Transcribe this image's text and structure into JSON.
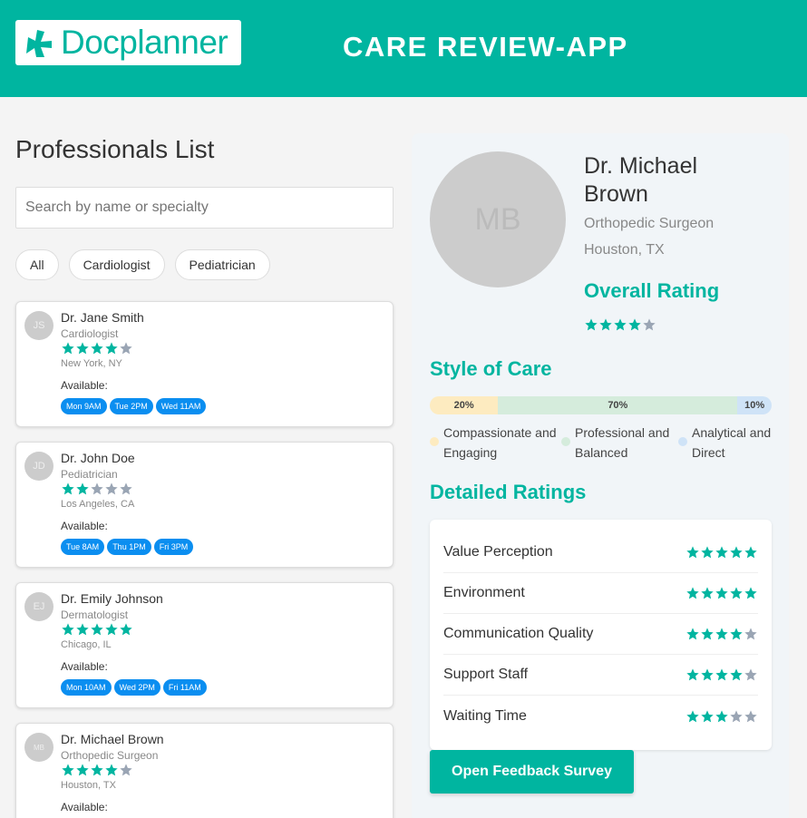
{
  "header": {
    "logo_text": "Docplanner",
    "app_title": "CARE REVIEW-APP"
  },
  "colors": {
    "brand": "#00b5a0",
    "slot_blue": "#0b8ef0",
    "star_filled": "#00b5a0",
    "star_empty": "#9aa5b4",
    "segment_compassionate": "#fdebc0",
    "segment_professional": "#d5ecdc",
    "segment_analytical": "#cfe3f7"
  },
  "list": {
    "title": "Professionals List",
    "search_placeholder": "Search by name or specialty",
    "filters": [
      "All",
      "Cardiologist",
      "Pediatrician"
    ],
    "available_label": "Available:",
    "doctors": [
      {
        "initials": "JS",
        "name": "Dr. Jane Smith",
        "specialty": "Cardiologist",
        "location": "New York, NY",
        "rating": 4,
        "slots": [
          "Mon 9AM",
          "Tue 2PM",
          "Wed 11AM"
        ]
      },
      {
        "initials": "JD",
        "name": "Dr. John Doe",
        "specialty": "Pediatrician",
        "location": "Los Angeles, CA",
        "rating": 2,
        "slots": [
          "Tue 8AM",
          "Thu 1PM",
          "Fri 3PM"
        ]
      },
      {
        "initials": "EJ",
        "name": "Dr. Emily Johnson",
        "specialty": "Dermatologist",
        "location": "Chicago, IL",
        "rating": 5,
        "slots": [
          "Mon 10AM",
          "Wed 2PM",
          "Fri 11AM"
        ]
      },
      {
        "initials": "MB",
        "name": "Dr. Michael Brown",
        "specialty": "Orthopedic Surgeon",
        "location": "Houston, TX",
        "rating": 4,
        "slots": []
      }
    ]
  },
  "detail": {
    "initials": "MB",
    "name": "Dr. Michael Brown",
    "specialty": "Orthopedic Surgeon",
    "location": "Houston, TX",
    "overall_title": "Overall Rating",
    "overall_rating": 4,
    "style_title": "Style of Care",
    "style_segments": [
      {
        "label": "20%",
        "percent": 20,
        "legend": "Compassionate and Engaging"
      },
      {
        "label": "70%",
        "percent": 70,
        "legend": "Professional and Balanced"
      },
      {
        "label": "10%",
        "percent": 10,
        "legend": "Analytical and Direct"
      }
    ],
    "detailed_title": "Detailed Ratings",
    "detailed_ratings": [
      {
        "label": "Value Perception",
        "rating": 5
      },
      {
        "label": "Environment",
        "rating": 5
      },
      {
        "label": "Communication Quality",
        "rating": 4
      },
      {
        "label": "Support Staff",
        "rating": 4
      },
      {
        "label": "Waiting Time",
        "rating": 3
      }
    ],
    "feedback_button": "Open Feedback Survey"
  }
}
